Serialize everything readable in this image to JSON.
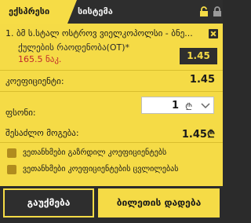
{
  "tabs": {
    "active_label": "ექსპრესი",
    "second_label": "სისტემა"
  },
  "header_icons": [
    "unlocked-icon",
    "locked-icon"
  ],
  "bet": {
    "title": "1. ბმ ს.სტალ ოსტროვ ვიელკოპოლსი - ბნე...",
    "market": "ქულების რაოდენობა(OT)*",
    "stake_amount": "165.5 ნაკ.",
    "odd": "1.45"
  },
  "coefficient": {
    "label": "კოეფიციენტი:",
    "value": "1.45"
  },
  "stake": {
    "label": "ფსონი:",
    "value": "1",
    "currency": "₾"
  },
  "possible_win": {
    "label": "შესაძლო მოგება:",
    "value": "1.45₾"
  },
  "options": [
    {
      "label": "ვეთანხმები გაზრდილ კოეფიციენტებს"
    },
    {
      "label": "ვეთანხმები კოეფიციენტების ცვლილებას"
    }
  ],
  "buttons": {
    "cancel": "გაუქმება",
    "place": "ბილეთის დადება"
  },
  "colors": {
    "accent": "#f5db46",
    "dark": "#2b2b2b",
    "stake_red": "#c1272d",
    "checkbox": "#b08c1e"
  }
}
